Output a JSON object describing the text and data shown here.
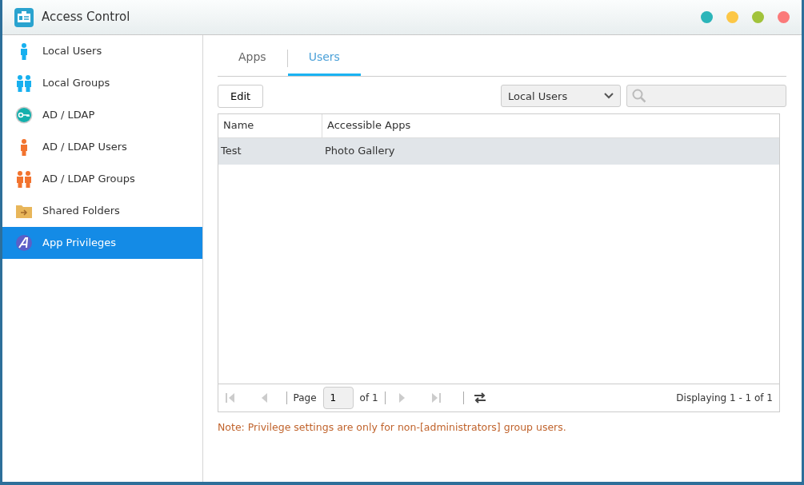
{
  "window": {
    "title": "Access Control"
  },
  "sidebar": {
    "items": [
      {
        "label": "Local Users",
        "kind": "user",
        "selected": false
      },
      {
        "label": "Local Groups",
        "kind": "group",
        "selected": false
      },
      {
        "label": "AD / LDAP",
        "kind": "key",
        "selected": false
      },
      {
        "label": "AD / LDAP Users",
        "kind": "ldap-user",
        "selected": false
      },
      {
        "label": "AD / LDAP Groups",
        "kind": "ldap-group",
        "selected": false
      },
      {
        "label": "Shared Folders",
        "kind": "folder",
        "selected": false
      },
      {
        "label": "App Privileges",
        "kind": "app",
        "selected": true
      }
    ]
  },
  "tabs": [
    {
      "label": "Apps",
      "selected": false
    },
    {
      "label": "Users",
      "selected": true
    }
  ],
  "toolbar": {
    "edit_button": "Edit",
    "filter": "Local Users"
  },
  "table": {
    "columns": [
      "Name",
      "Accessible Apps"
    ],
    "rows": [
      {
        "cells": [
          "Test",
          "Photo Gallery"
        ],
        "selected": true
      }
    ]
  },
  "pager": {
    "page_label": "Page",
    "page": "1",
    "of": "of 1",
    "display": "Displaying 1 - 1 of 1"
  },
  "note": "Note: Privilege settings are only for non-[administrators] group users."
}
